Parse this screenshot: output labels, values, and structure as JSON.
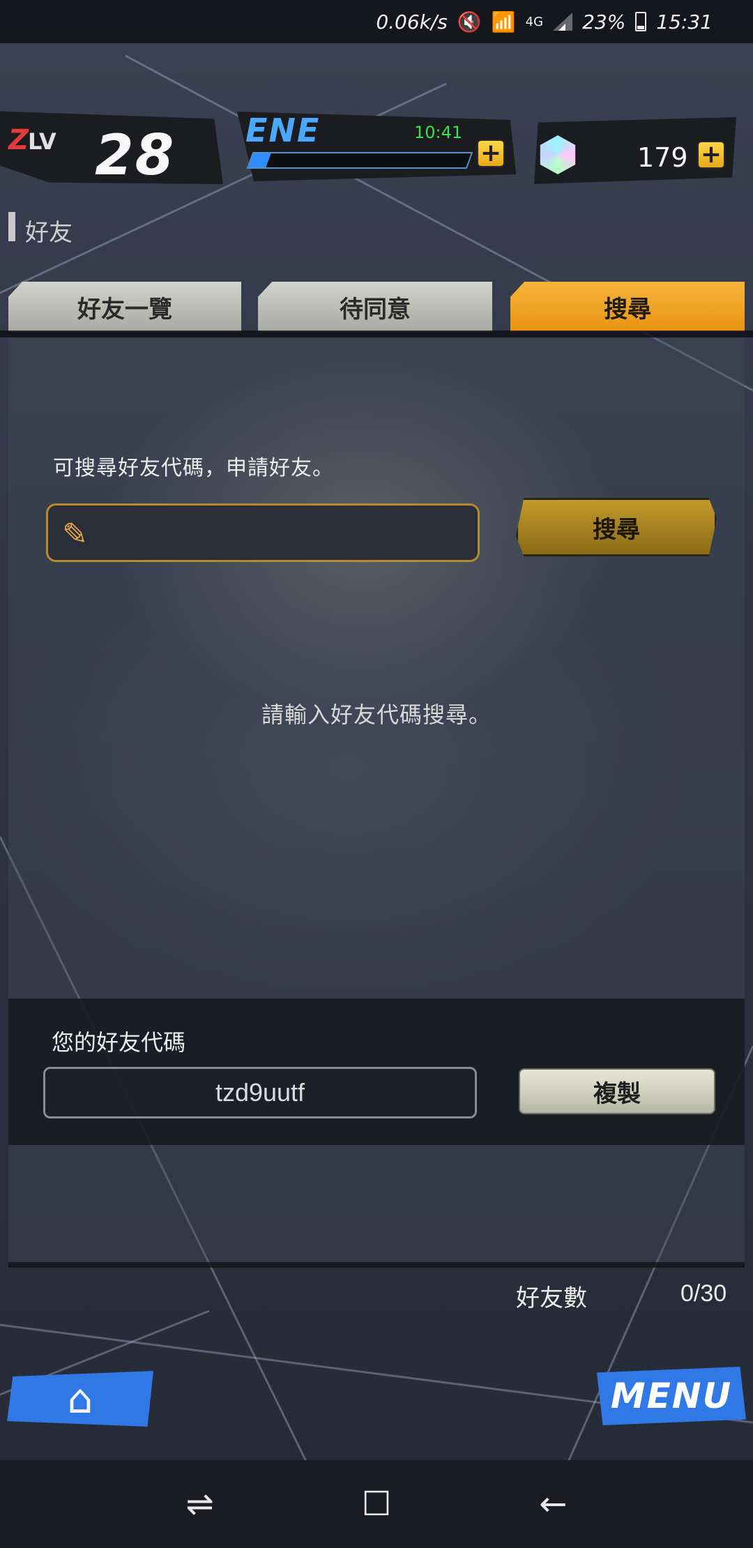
{
  "status_bar": {
    "speed": "0.06k/s",
    "mute_icon": "mute-icon",
    "wifi_icon": "wifi-icon",
    "network": "4G",
    "battery_percent": "23%",
    "time": "15:31"
  },
  "hud": {
    "level_z": "Z",
    "level_prefix": "LV",
    "level": "28",
    "ene_label": "ENE",
    "ene_timer": "10:41",
    "ene_fill": 0.08,
    "gems": "179",
    "plus_glyph": "+"
  },
  "section": {
    "title": "好友"
  },
  "tabs": [
    {
      "label": "好友一覽",
      "active": false
    },
    {
      "label": "待同意",
      "active": false
    },
    {
      "label": "搜尋",
      "active": true
    }
  ],
  "search": {
    "hint": "可搜尋好友代碼，申請好友。",
    "input_value": "",
    "button_label": "搜尋",
    "empty_message": "請輸入好友代碼搜尋。"
  },
  "my_code": {
    "label": "您的好友代碼",
    "value": "tzd9uutf",
    "copy_label": "複製"
  },
  "friend_count": {
    "label": "好友數",
    "value": "0/30"
  },
  "bottom": {
    "menu_label": "MENU",
    "home_icon": "home-icon"
  },
  "colors": {
    "accent_orange": "#e89312",
    "ene_blue": "#2f8cff",
    "timer_green": "#3ee04a",
    "button_blue": "#2f78e6"
  }
}
